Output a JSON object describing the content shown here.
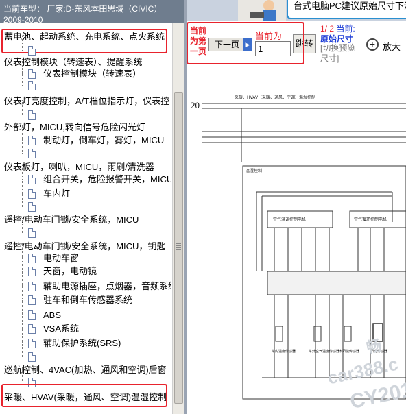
{
  "car_header": "当前车型：  厂家:D-东风本田思域（CIVIC）2009-2010",
  "tree": [
    {
      "type": "section",
      "label": "蓄电池、起动系统、充电系统、点火系统",
      "highlight": true
    },
    {
      "type": "doc",
      "label": ""
    },
    {
      "type": "section",
      "label": "仪表控制模块（转速表）、提醒系统"
    },
    {
      "type": "doc",
      "label": "仪表控制模块（转速表）"
    },
    {
      "type": "doc",
      "label": ""
    },
    {
      "type": "section",
      "label": "仪表灯亮度控制，A/T档位指示灯，仪表控"
    },
    {
      "type": "doc",
      "label": ""
    },
    {
      "type": "section",
      "label": "外部灯，MICU,转向信号危险闪光灯"
    },
    {
      "type": "doc",
      "label": "制动灯，倒车灯，雾灯，MICU"
    },
    {
      "type": "doc",
      "label": ""
    },
    {
      "type": "section",
      "label": "仪表板灯，喇叭，MICU，雨刷/清洗器"
    },
    {
      "type": "doc",
      "label": "组合开关，危险报警开关，MICU"
    },
    {
      "type": "doc",
      "label": "车内灯"
    },
    {
      "type": "doc",
      "label": ""
    },
    {
      "type": "section",
      "label": "遥控/电动车门锁/安全系统，MICU"
    },
    {
      "type": "doc",
      "label": ""
    },
    {
      "type": "section",
      "label": "遥控/电动车门锁/安全系统，MICU，钥匙"
    },
    {
      "type": "doc",
      "label": "电动车窗"
    },
    {
      "type": "doc",
      "label": "天窗，电动镜"
    },
    {
      "type": "doc",
      "label": "辅助电源插座，点烟器，音频系统"
    },
    {
      "type": "doc",
      "label": "驻车和倒车传感器系统"
    },
    {
      "type": "doc",
      "label": "ABS"
    },
    {
      "type": "doc",
      "label": "VSA系统"
    },
    {
      "type": "doc",
      "label": "辅助保护系统(SRS)"
    },
    {
      "type": "doc",
      "label": ""
    },
    {
      "type": "section",
      "label": "巡航控制、4VAC(加热、通风和空调)后窗"
    },
    {
      "type": "doc",
      "label": ""
    },
    {
      "type": "section",
      "label": "采暖、HVAV(采暖，通风、空调)温湿控制",
      "highlight": true
    }
  ],
  "banner_text": "台式电脑PC建议原始尺寸下浏",
  "toolbar": {
    "prev_label": "当前为第一页",
    "next_button": "下一页",
    "current_page_label": "当前为",
    "current_page_value": "1",
    "jump_button": "跳转",
    "page_count": "1/ 2",
    "current_label": "当前:",
    "original_size": "原始尺寸",
    "switch_size": "[切换预览尺寸]",
    "zoom_label": "放大"
  },
  "document": {
    "page_number": "20",
    "title": "采暖、HVAV（采暖、通风、空调）温湿控制",
    "module_label": "温湿控制",
    "box1": "空气温调控制电机",
    "box2": "空气循环控制电机",
    "sensor1": "车内温度传感器",
    "sensor2": "车外空气温度传感器",
    "sensor3": "太阳能传感器",
    "sensor4": "阳光传感器",
    "watermark1": "畅",
    "watermark2": "car388.c",
    "watermark3": "CY201"
  }
}
